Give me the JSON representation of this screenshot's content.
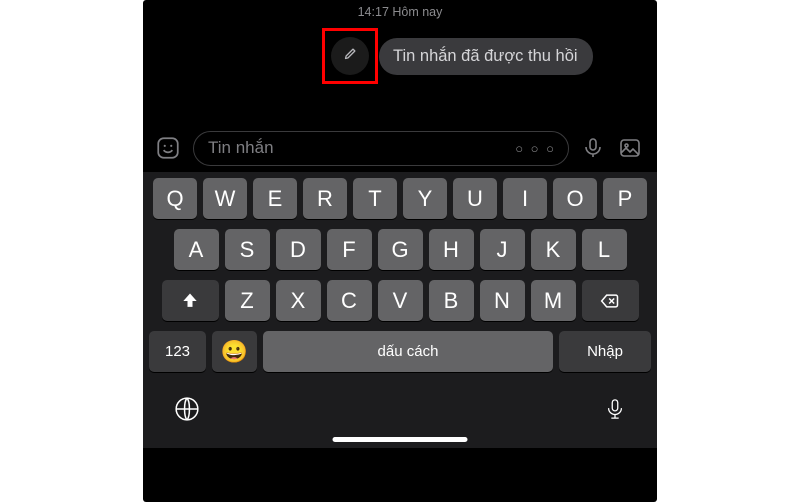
{
  "timestamp": "14:17 Hôm nay",
  "message": "Tin nhắn đã được thu hồi",
  "composer": {
    "placeholder": "Tin nhắn",
    "more": "○ ○ ○"
  },
  "keyboard": {
    "row1": [
      "Q",
      "W",
      "E",
      "R",
      "T",
      "Y",
      "U",
      "I",
      "O",
      "P"
    ],
    "row2": [
      "A",
      "S",
      "D",
      "F",
      "G",
      "H",
      "J",
      "K",
      "L"
    ],
    "row3": [
      "Z",
      "X",
      "C",
      "V",
      "B",
      "N",
      "M"
    ],
    "numKey": "123",
    "emoji": "😀",
    "space": "dấu cách",
    "enter": "Nhập"
  }
}
